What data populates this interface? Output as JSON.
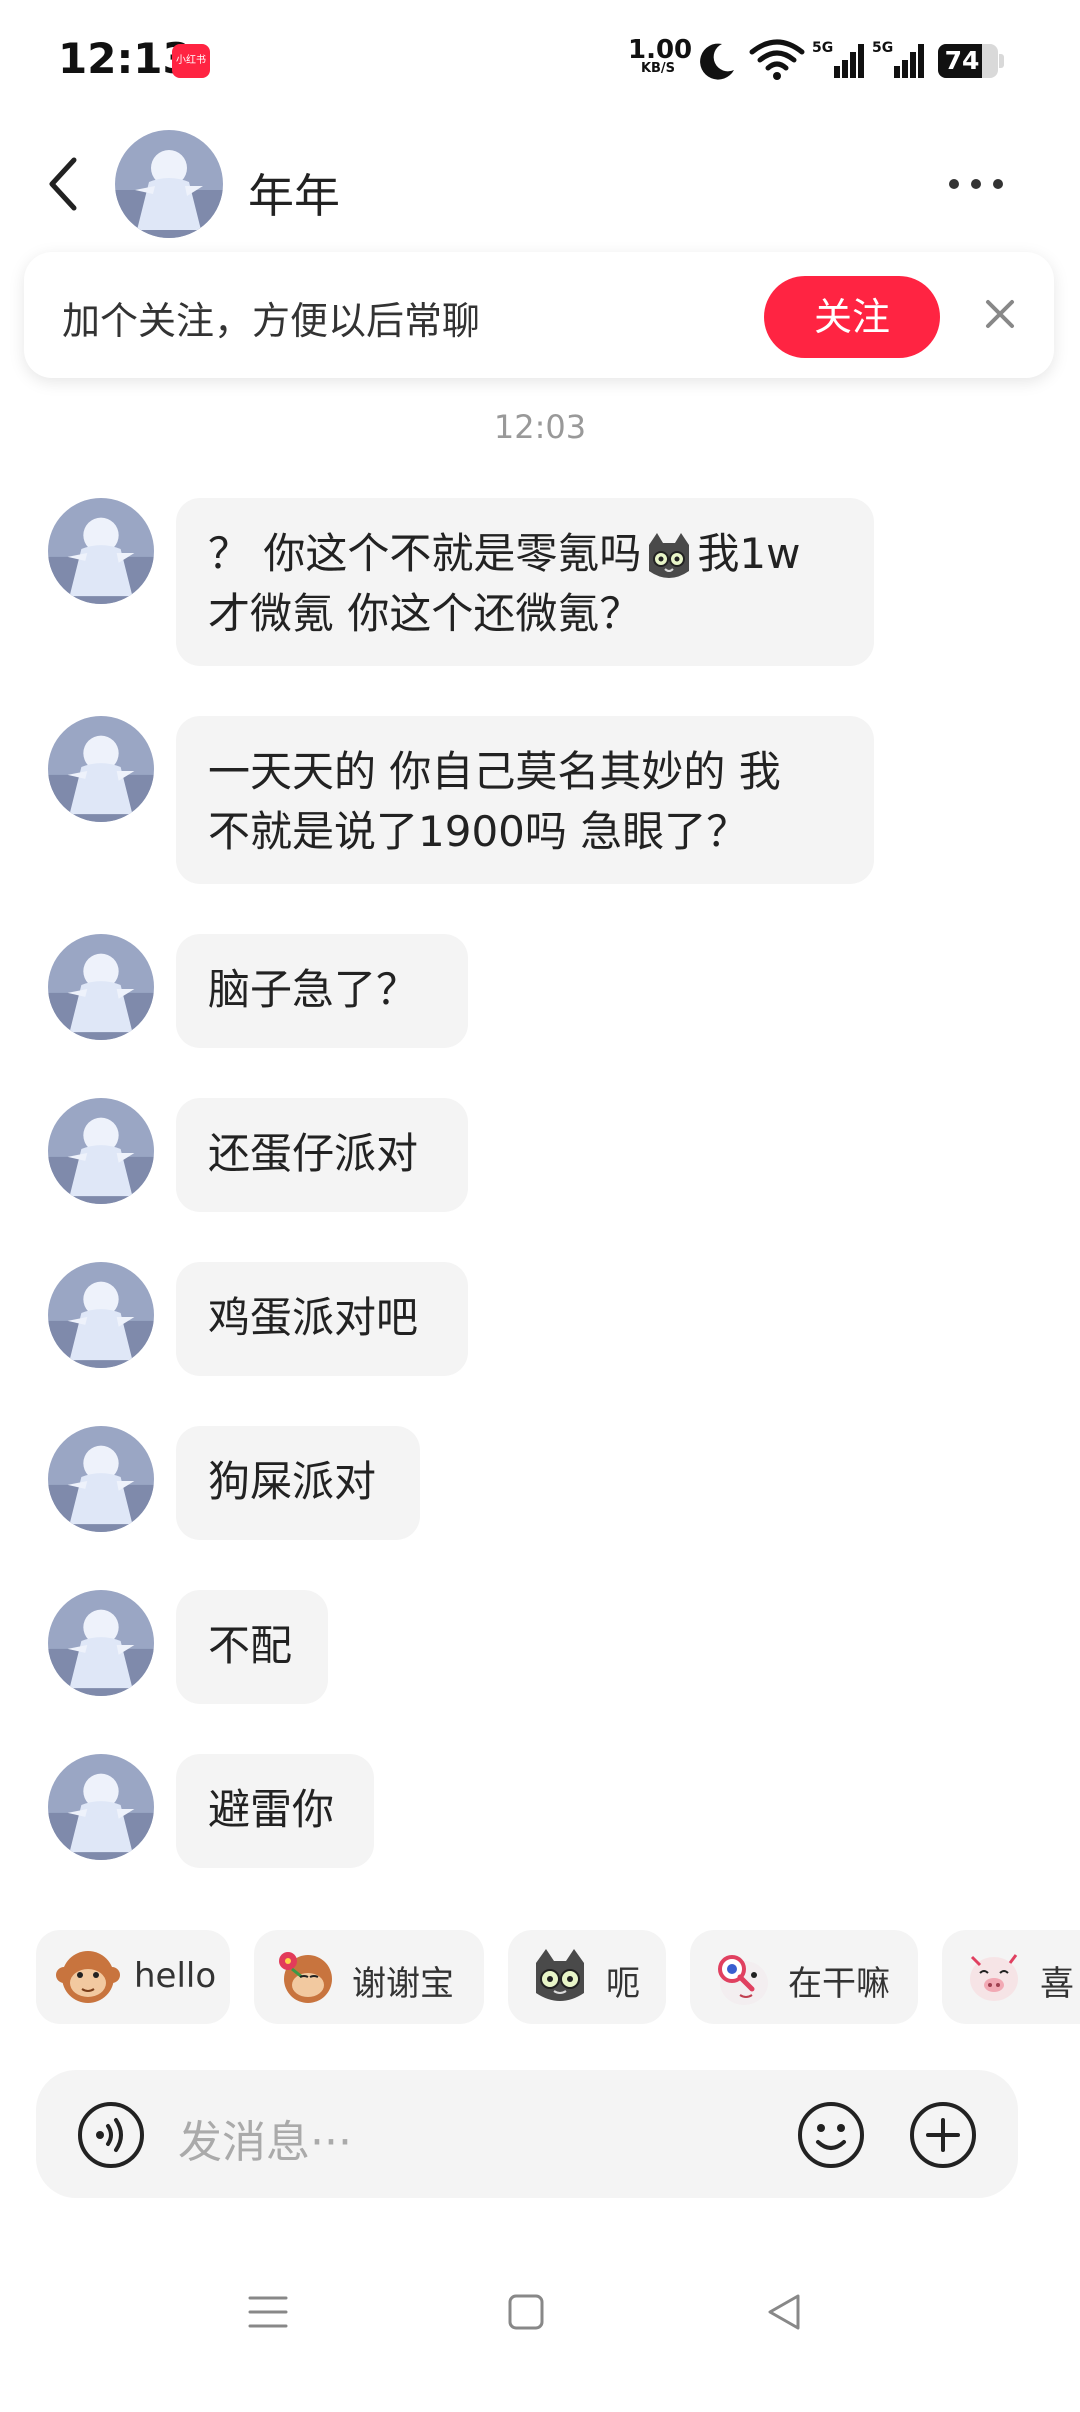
{
  "status_bar": {
    "time": "12:13",
    "app_badge": "小红书",
    "net_speed_value": "1.00",
    "net_speed_unit": "KB/S",
    "signal_1_label": "5G",
    "signal_2_label": "5G",
    "battery_level": "74",
    "icons": [
      "moon-icon",
      "wifi-icon",
      "signal-icon",
      "battery-icon"
    ]
  },
  "header": {
    "back_icon": "chevron-left-icon",
    "contact_name": "年年",
    "more_icon": "more-dots-icon"
  },
  "follow_banner": {
    "text": "加个关注，方便以后常聊",
    "button_label": "关注",
    "close_icon": "close-icon"
  },
  "chat": {
    "timestamp": "12:03",
    "messages": [
      {
        "parts": [
          "？ 你这个不就是零氪吗",
          "我1w\n才微氪 你这个还微氪？"
        ],
        "inline_emoji": "cat-face-emoji"
      },
      {
        "text": "一天天的 你自己莫名其妙的 我\n不就是说了1900吗 急眼了？"
      },
      {
        "text": "脑子急了？"
      },
      {
        "text": "还蛋仔派对"
      },
      {
        "text": "鸡蛋派对吧"
      },
      {
        "text": "狗屎派对"
      },
      {
        "text": "不配"
      },
      {
        "text": "避雷你"
      }
    ]
  },
  "quick_replies": [
    {
      "label": "hello",
      "icon": "monkey-emoji"
    },
    {
      "label": "谢谢宝",
      "icon": "monkey-flower-emoji"
    },
    {
      "label": "呃",
      "icon": "cat-face-emoji"
    },
    {
      "label": "在干嘛",
      "icon": "magnifier-creature-emoji"
    },
    {
      "label": "喜",
      "icon": "pig-emoji"
    }
  ],
  "input": {
    "placeholder": "发消息···",
    "voice_icon": "voice-icon",
    "emoji_icon": "smile-icon",
    "plus_icon": "plus-circle-icon"
  },
  "nav": {
    "icons": [
      "menu-icon",
      "home-square-icon",
      "back-triangle-icon"
    ]
  },
  "colors": {
    "accent": "#ff2442",
    "bubble_bg": "#f4f4f4",
    "timestamp": "#999999"
  }
}
